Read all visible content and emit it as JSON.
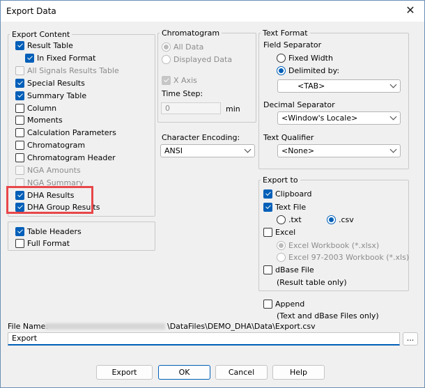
{
  "window": {
    "title": "Export Data"
  },
  "export_content": {
    "legend": "Export Content",
    "items": [
      {
        "label": "Result Table",
        "checked": true,
        "disabled": false
      },
      {
        "label": "In Fixed Format",
        "checked": true,
        "disabled": false
      },
      {
        "label": "All Signals Results Table",
        "checked": false,
        "disabled": true
      },
      {
        "label": "Special Results",
        "checked": true,
        "disabled": false
      },
      {
        "label": "Summary Table",
        "checked": true,
        "disabled": false
      },
      {
        "label": "Column",
        "checked": false,
        "disabled": false
      },
      {
        "label": "Moments",
        "checked": false,
        "disabled": false
      },
      {
        "label": "Calculation Parameters",
        "checked": false,
        "disabled": false
      },
      {
        "label": "Chromatogram",
        "checked": false,
        "disabled": false
      },
      {
        "label": "Chromatogram Header",
        "checked": false,
        "disabled": false
      },
      {
        "label": "NGA Amounts",
        "checked": false,
        "disabled": true
      },
      {
        "label": "NGA Summary",
        "checked": false,
        "disabled": true
      },
      {
        "label": "DHA Results",
        "checked": true,
        "disabled": false
      },
      {
        "label": "DHA Group Results",
        "checked": true,
        "disabled": false
      }
    ]
  },
  "headers_group": {
    "table_headers": "Table Headers",
    "full_format": "Full Format"
  },
  "chromatogram": {
    "legend": "Chromatogram",
    "all_data": "All Data",
    "displayed_data": "Displayed Data",
    "x_axis": "X Axis",
    "time_step_label": "Time Step:",
    "time_step_value": "0",
    "time_step_unit": "min"
  },
  "character_encoding": {
    "label": "Character Encoding:",
    "value": "ANSI"
  },
  "text_format": {
    "legend": "Text Format",
    "field_separator_label": "Field Separator",
    "fixed_width": "Fixed Width",
    "delimited_by": "Delimited by:",
    "delimiter_value": "<TAB>",
    "decimal_separator_label": "Decimal Separator",
    "decimal_separator_value": "<Window's Locale>",
    "text_qualifier_label": "Text Qualifier",
    "text_qualifier_value": "<None>"
  },
  "export_to": {
    "legend": "Export to",
    "clipboard": "Clipboard",
    "text_file": "Text File",
    "txt": ".txt",
    "csv": ".csv",
    "excel": "Excel",
    "excel_xlsx": "Excel Workbook (*.xlsx)",
    "excel_xls": "Excel 97-2003 Workbook (*.xls)",
    "dbase": "dBase File",
    "dbase_note": "(Result table only)"
  },
  "append": {
    "label": "Append",
    "note": "(Text and dBase Files only)"
  },
  "file_name": {
    "label": "File Name:",
    "path": "\\DataFiles\\DEMO_DHA\\Data\\Export.csv",
    "value": "Export",
    "browse": "..."
  },
  "buttons": {
    "export": "Export",
    "ok": "OK",
    "cancel": "Cancel",
    "help": "Help"
  },
  "colors": {
    "accent": "#005fb8",
    "highlight": "#e8474a"
  }
}
